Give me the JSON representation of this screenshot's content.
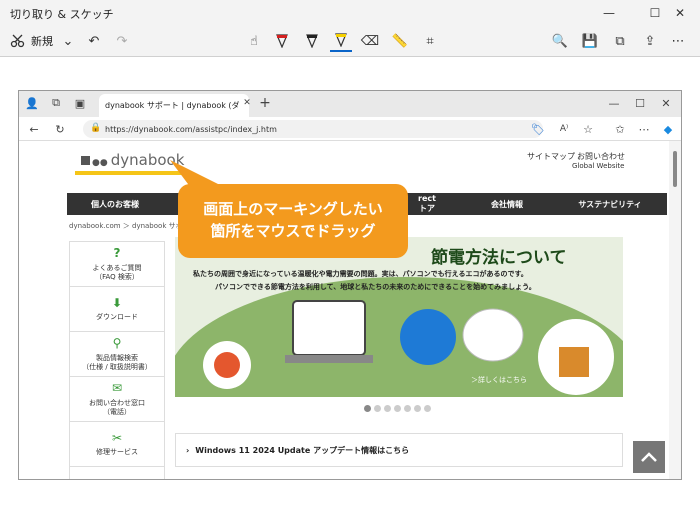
{
  "app": {
    "title": "切り取り & スケッチ",
    "new_label": "新規"
  },
  "browser": {
    "tab_title": "dynabook サポート | dynabook (ダ",
    "url": "https://dynabook.com/assistpc/index_j.htm"
  },
  "page": {
    "logo": "dynabook",
    "top_links": [
      "サイトマップ",
      "お問い合わせ"
    ],
    "global_link": "Global Website",
    "nav": [
      "個人のお客様",
      "rect",
      "トア",
      "会社情報",
      "サステナビリティ"
    ],
    "breadcrumb": "dynabook.com ＞ dynabook サポート",
    "side_items": [
      {
        "line1": "よくあるご質問",
        "line2": "（FAQ 検索）"
      },
      {
        "line1": "ダウンロード",
        "line2": ""
      },
      {
        "line1": "製品情報検索",
        "line2": "（仕様 / 取扱説明書）"
      },
      {
        "line1": "お問い合わせ窓口",
        "line2": "（電話）"
      },
      {
        "line1": "修理サービス",
        "line2": ""
      }
    ],
    "banner": {
      "title": "節電方法について",
      "line1": "私たちの周囲で身近になっている温暖化や電力需要の問題。実は、パソコンでも行えるエコがあるのです。",
      "line2": "パソコンでできる節電方法を利用して、地球と私たちの未来のためにできることを始めてみましょう。",
      "link": "＞詳しくはこちら"
    },
    "win_notice": "Windows 11 2024 Update アップデート情報はこちら"
  },
  "callout": {
    "line1": "画面上のマーキングしたい",
    "line2": "箇所をマウスでドラッグ"
  },
  "colors": {
    "accent": "#f39a1e",
    "highlighter": "#f5c518",
    "nav_bg": "#333333",
    "banner_green": "#7aa35a"
  }
}
